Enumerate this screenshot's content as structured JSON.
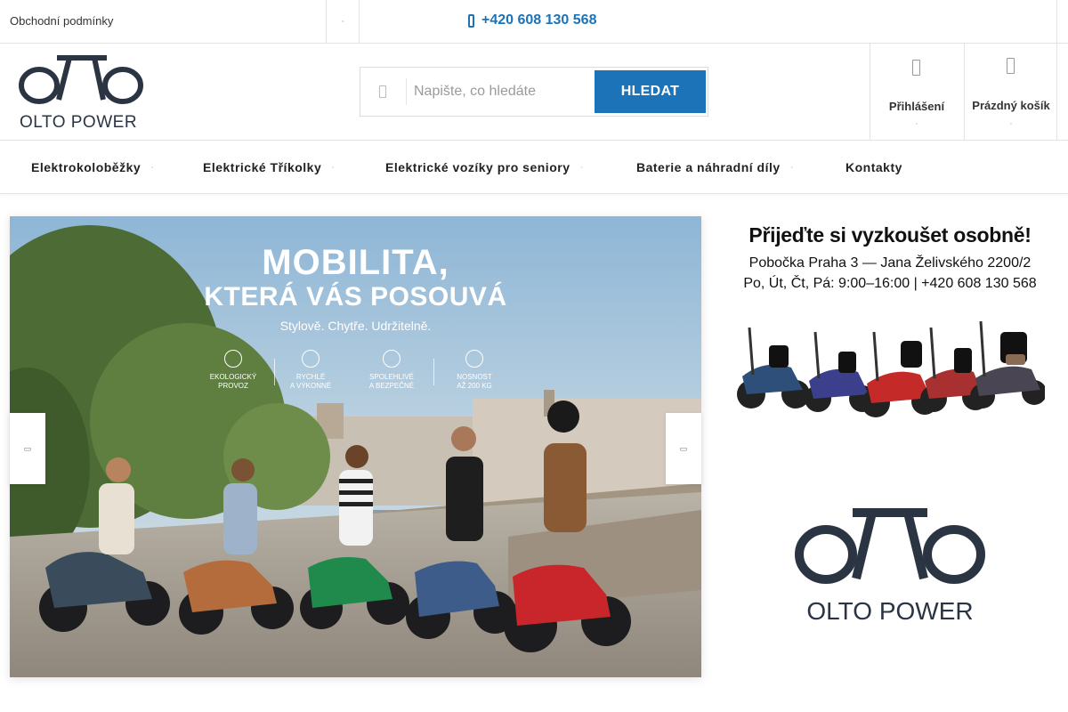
{
  "topbar": {
    "terms_link": "Obchodní podmínky",
    "dropdown_glyph": "▫",
    "phone": "+420 608 130 568"
  },
  "header": {
    "logo_text": "OLTO POWER",
    "search": {
      "placeholder": "Napište, co hledáte",
      "button_label": "HLEDAT"
    },
    "account": {
      "label": "Přihlášení",
      "icon": "user-icon"
    },
    "cart": {
      "label": "Prázdný košík",
      "icon": "cart-icon"
    },
    "caret_glyph": "▫"
  },
  "nav": {
    "items": [
      {
        "label": "Elektrokoloběžky",
        "has_submenu": true
      },
      {
        "label": "Elektrické Tříkolky",
        "has_submenu": true
      },
      {
        "label": "Elektrické vozíky pro seniory",
        "has_submenu": true
      },
      {
        "label": "Baterie a náhradní díly",
        "has_submenu": true
      },
      {
        "label": "Kontakty",
        "has_submenu": false
      }
    ],
    "caret_glyph": "▫"
  },
  "hero": {
    "title_line1": "MOBILITA,",
    "title_line2": "KTERÁ VÁS POSOUVÁ",
    "subtitle": "Stylově. Chytře. Udržitelně.",
    "features": [
      {
        "icon": "leaf-icon",
        "line1": "EKOLOGICKÝ",
        "line2": "PROVOZ"
      },
      {
        "icon": "lightning-icon",
        "line1": "RYCHLÉ",
        "line2": "A VÝKONNÉ"
      },
      {
        "icon": "shield-icon",
        "line1": "SPOLEHLIVÉ",
        "line2": "A BEZPEČNÉ"
      },
      {
        "icon": "weight-icon",
        "line1": "NOSNOST",
        "line2": "AŽ 200 KG"
      }
    ],
    "prev_glyph": "▭",
    "next_glyph": "▭"
  },
  "promo": {
    "title": "Přijeďte si vyzkoušet osobně!",
    "line1": "Pobočka Praha 3  —  Jana Želivského 2200/2",
    "line2": "Po, Út, Čt, Pá: 9:00–16:00 | +420 608 130 568",
    "logo_text": "OLTO POWER"
  },
  "colors": {
    "accent": "#1c73b8",
    "logo": "#2b3442"
  }
}
